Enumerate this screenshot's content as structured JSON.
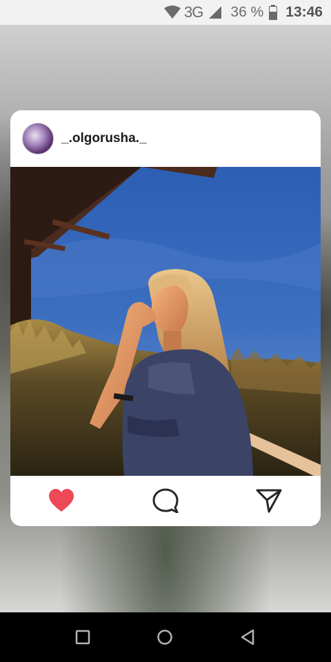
{
  "status_bar": {
    "network": "3G",
    "battery": "36 %",
    "time": "13:46"
  },
  "post": {
    "username": "_.olgorusha._",
    "avatar_icon": "avatar-illustration",
    "photo": "girl-at-dusk-photo",
    "actions": {
      "like_icon": "heart-icon",
      "like_color": "#ed4956",
      "comment_icon": "comment-icon",
      "share_icon": "send-icon"
    }
  },
  "nav_bar": {
    "recent_icon": "square-icon",
    "home_icon": "circle-icon",
    "back_icon": "triangle-back-icon"
  }
}
